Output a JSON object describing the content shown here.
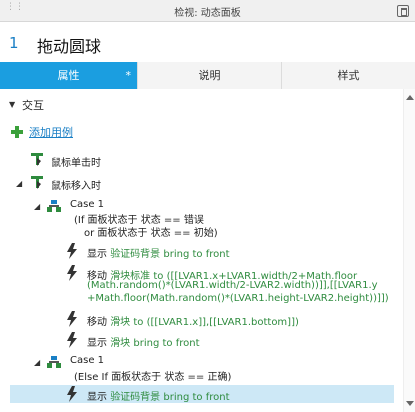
{
  "window": {
    "title": "检视: 动态面板"
  },
  "header": {
    "number": "1",
    "name": "拖动圆球"
  },
  "tabs": [
    {
      "label": "属性",
      "marker": "*"
    },
    {
      "label": "说明"
    },
    {
      "label": "样式"
    }
  ],
  "section": {
    "title": "交互",
    "add_case_label": "添加用例"
  },
  "events": [
    {
      "label": "鼠标单击时"
    },
    {
      "label": "鼠标移入时"
    }
  ],
  "cases": [
    {
      "title": "Case 1",
      "condition_line1": "(If 面板状态于 状态 == 错误",
      "condition_line2": "or 面板状态于 状态 == 初始)",
      "actions": [
        {
          "verb": "显示",
          "target": "验证码背景",
          "detail": "bring to front"
        },
        {
          "verb": "移动",
          "target": "滑块标准",
          "detail": "to ([[LVAR1.x+LVAR1.width/2+Math.floor",
          "detail2": "(Math.random()*(LVAR1.width/2-LVAR2.width))]],[[LVAR1.y",
          "detail3": "+Math.floor(Math.random()*(LVAR1.height-LVAR2.height))]])"
        },
        {
          "verb": "移动",
          "target": "滑块",
          "detail": "to ([[LVAR1.x]],[[LVAR1.bottom]])"
        },
        {
          "verb": "显示",
          "target": "滑块",
          "detail": "bring to front"
        }
      ]
    },
    {
      "title": "Case 1",
      "condition_line1": "(Else If 面板状态于 状态 == 正确)",
      "actions": [
        {
          "verb": "显示",
          "target": "验证码背景",
          "detail": "bring to front"
        }
      ]
    }
  ],
  "colors": {
    "accent": "#1b9ee0",
    "green": "#2e8b3e",
    "link": "#1a7fc5",
    "selection": "#cde8f6"
  }
}
